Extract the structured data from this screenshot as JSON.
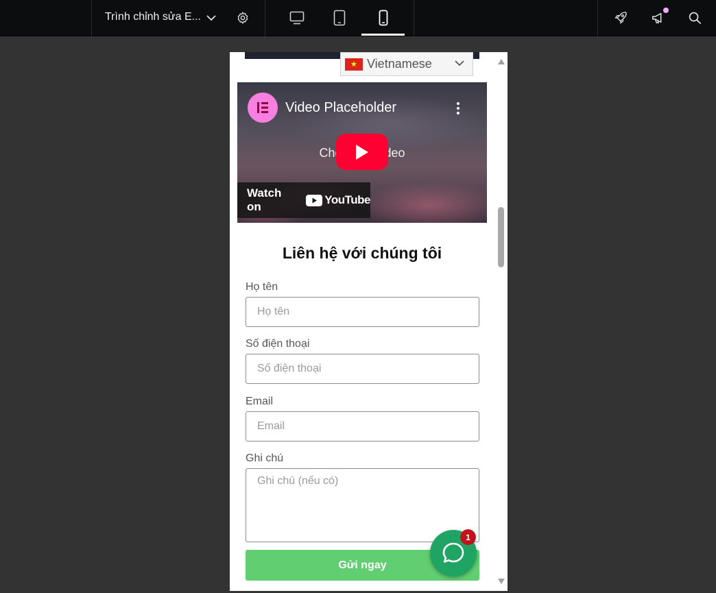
{
  "topbar": {
    "editor_title": "Trình chỉnh sửa E...",
    "icons": [
      "chevron-down-icon",
      "gear-icon",
      "desktop-icon",
      "tablet-icon",
      "mobile-icon",
      "rocket-icon",
      "megaphone-icon",
      "search-icon"
    ],
    "active_device": "mobile",
    "notification_color": "#f0abfc"
  },
  "language_switcher": {
    "selected": "Vietnamese",
    "flag": "vietnam-flag"
  },
  "video": {
    "title": "Video Placeholder",
    "hint": "Choose a video",
    "watch_label": "Watch on",
    "platform": "YouTube",
    "logo_color": "#f77fe0",
    "play_color": "#ff0033"
  },
  "contact_form": {
    "title": "Liên hệ với chúng tôi",
    "fields": [
      {
        "label": "Họ tên",
        "placeholder": "Họ tên"
      },
      {
        "label": "Số điện thoại",
        "placeholder": "Số điện thoại"
      },
      {
        "label": "Email",
        "placeholder": "Email"
      },
      {
        "label": "Ghi chú",
        "placeholder": "Ghi chú (nếu có)"
      }
    ],
    "submit_label": "Gửi ngay",
    "submit_color": "#62ce72"
  },
  "chat_widget": {
    "badge_count": "1",
    "color": "#1fa463"
  }
}
